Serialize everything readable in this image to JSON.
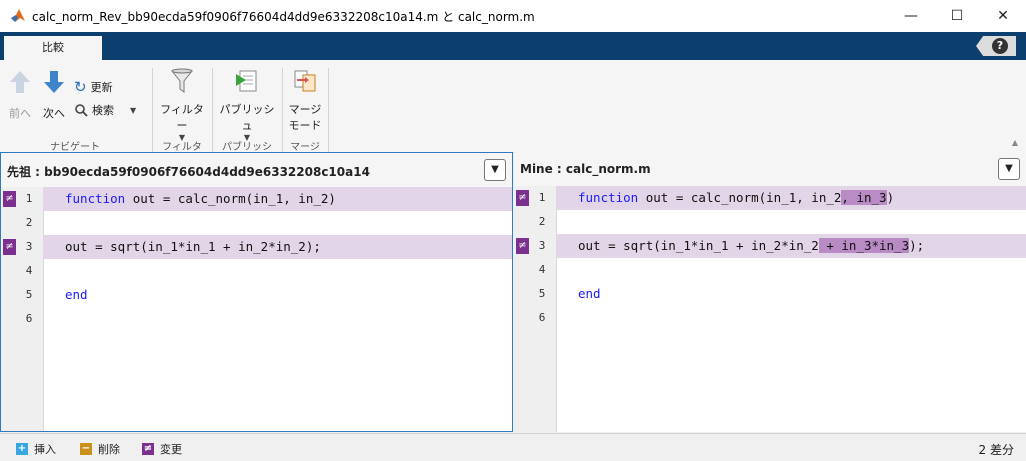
{
  "window": {
    "title": "calc_norm_Rev_bb90ecda59f0906f76604d4dd9e6332208c10a14.m と calc_norm.m",
    "app_icon": "matlab-icon",
    "controls": {
      "minimize": "—",
      "maximize": "☐",
      "close": "✕"
    }
  },
  "tabs": [
    {
      "label": "比較",
      "selected": true
    }
  ],
  "help": {
    "icon": "help-icon",
    "glyph": "?"
  },
  "ribbon": {
    "navigation": {
      "prev_label": "前へ",
      "next_label": "次へ",
      "refresh_label": "更新",
      "search_label": "検索",
      "section": "ナビゲート"
    },
    "filter": {
      "label": "フィルター",
      "section": "フィルター"
    },
    "publish": {
      "label": "パブリッシュ",
      "section": "パブリッシュ"
    },
    "merge": {
      "label_line1": "マージ",
      "label_line2": "モード",
      "section": "マージ"
    }
  },
  "left_pane": {
    "header": "先祖 : bb90ecda59f0906f76604d4dd9e6332208c10a14",
    "lines": [
      {
        "num": "1",
        "changed": true
      },
      {
        "num": "2",
        "changed": false
      },
      {
        "num": "3",
        "changed": true
      },
      {
        "num": "4",
        "changed": false
      },
      {
        "num": "5",
        "changed": false
      },
      {
        "num": "6",
        "changed": false
      }
    ],
    "code": {
      "l1_kw": "function",
      "l1_rest": " out = calc_norm(in_1, in_2)",
      "l3": "out = sqrt(in_1*in_1 + in_2*in_2);",
      "l5_kw": "end"
    }
  },
  "right_pane": {
    "header": "Mine : calc_norm.m",
    "lines": [
      {
        "num": "1",
        "changed": true
      },
      {
        "num": "2",
        "changed": false
      },
      {
        "num": "3",
        "changed": true
      },
      {
        "num": "4",
        "changed": false
      },
      {
        "num": "5",
        "changed": false
      },
      {
        "num": "6",
        "changed": false
      }
    ],
    "code": {
      "l1_kw": "function",
      "l1_pre": " out = calc_norm(in_1, in_2",
      "l1_hl": ", in_3",
      "l1_post": ")",
      "l3_pre": "out = sqrt(in_1*in_1 + in_2*in_2",
      "l3_hl": " + in_3*in_3",
      "l3_post": ");",
      "l5_kw": "end"
    }
  },
  "change_marker": "≠",
  "statusbar": {
    "legend": [
      {
        "label": "挿入",
        "glyph": "+",
        "color": "#3aa6e0"
      },
      {
        "label": "削除",
        "glyph": "−",
        "color": "#c9901c"
      },
      {
        "label": "変更",
        "glyph": "≠",
        "color": "#7b2f8e"
      }
    ],
    "diff_count": "2 差分"
  },
  "colors": {
    "ribbon_tab_bar": "#0c3e6e",
    "changed_line_bg": "#e3d5e8",
    "inline_highlight": "#b98bc5",
    "keyword": "#1a1aff"
  }
}
